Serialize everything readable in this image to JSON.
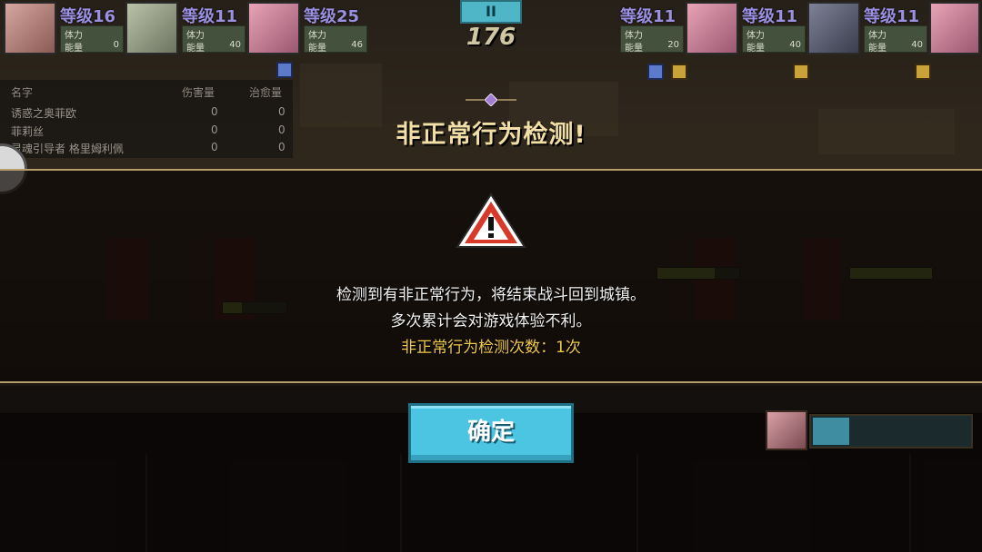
{
  "hud": {
    "left_players": [
      {
        "level": "等级16",
        "stamina_label": "体力",
        "energy_label": "能量",
        "energy_value": "0"
      },
      {
        "level": "等级11",
        "stamina_label": "体力",
        "energy_label": "能量",
        "energy_value": "40"
      },
      {
        "level": "等级25",
        "stamina_label": "体力",
        "energy_label": "能量",
        "energy_value": "46"
      }
    ],
    "right_players": [
      {
        "level": "等级11",
        "stamina_label": "体力",
        "energy_label": "能量",
        "energy_value": "20"
      },
      {
        "level": "等级11",
        "stamina_label": "体力",
        "energy_label": "能量",
        "energy_value": "40"
      },
      {
        "level": "等级11",
        "stamina_label": "体力",
        "energy_label": "能量",
        "energy_value": "40"
      }
    ],
    "pause_label": "II",
    "timer": "176"
  },
  "damage_table": {
    "headers": {
      "name": "名字",
      "damage": "伤害量",
      "heal": "治愈量"
    },
    "rows": [
      {
        "name": "诱惑之奥菲欧",
        "damage": "0",
        "heal": "0"
      },
      {
        "name": "菲莉丝",
        "damage": "0",
        "heal": "0"
      },
      {
        "name": "灵魂引导者 格里姆利佩",
        "damage": "0",
        "heal": "0"
      }
    ]
  },
  "modal": {
    "title": "非正常行为检测!",
    "icon": "warning-triangle-icon",
    "line1": "检测到有非正常行为，将结束战斗回到城镇。",
    "line2": "多次累计会对游戏体验不利。",
    "count_line": "非正常行为检测次数：1次",
    "confirm_label": "确定"
  },
  "colors": {
    "panel_border": "#b69e6c",
    "title": "#f1dfa6",
    "count_text": "#f1ca4a",
    "button": "#4cc5e3",
    "warning_red": "#d83a2a"
  }
}
